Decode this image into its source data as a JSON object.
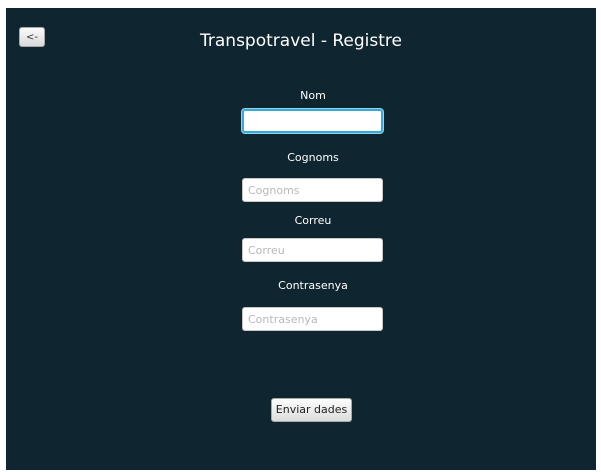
{
  "header": {
    "back_label": "<-",
    "title": "Transpotravel - Registre"
  },
  "form": {
    "nom": {
      "label": "Nom",
      "value": "",
      "placeholder": ""
    },
    "cognoms": {
      "label": "Cognoms",
      "value": "",
      "placeholder": "Cognoms"
    },
    "correu": {
      "label": "Correu",
      "value": "",
      "placeholder": "Correu"
    },
    "contrasenya": {
      "label": "Contrasenya",
      "value": "",
      "placeholder": "Contrasenya"
    },
    "submit_label": "Enviar dades"
  },
  "colors": {
    "background": "#0f2530",
    "focus_ring": "#39a9d8"
  }
}
